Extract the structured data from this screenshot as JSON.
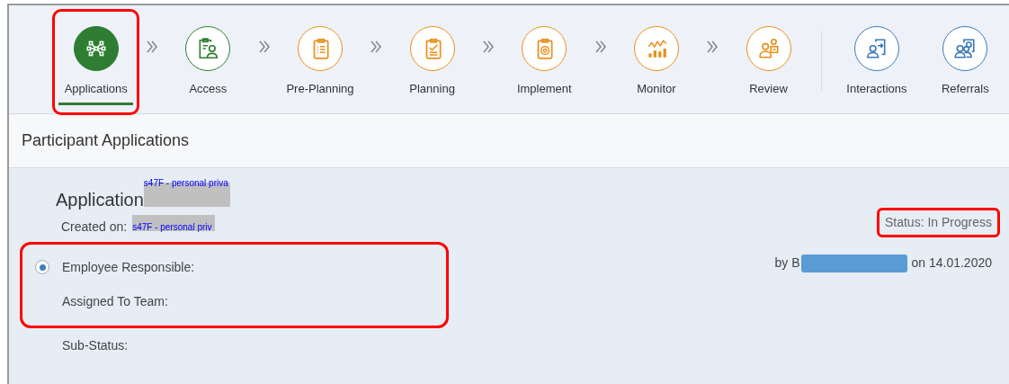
{
  "steps": [
    {
      "label": "Applications",
      "kind": "process",
      "completed": true,
      "selected": true,
      "highlighted": true
    },
    {
      "label": "Access",
      "kind": "process",
      "completed": true,
      "selected": false,
      "highlighted": false
    },
    {
      "label": "Pre-Planning",
      "kind": "process",
      "completed": false,
      "selected": false,
      "highlighted": false
    },
    {
      "label": "Planning",
      "kind": "process",
      "completed": false,
      "selected": false,
      "highlighted": false
    },
    {
      "label": "Implement",
      "kind": "process",
      "completed": false,
      "selected": false,
      "highlighted": false
    },
    {
      "label": "Monitor",
      "kind": "process",
      "completed": false,
      "selected": false,
      "highlighted": false
    },
    {
      "label": "Review",
      "kind": "process",
      "completed": false,
      "selected": false,
      "highlighted": false
    },
    {
      "label": "Interactions",
      "kind": "related",
      "selected": false,
      "highlighted": false
    },
    {
      "label": "Referrals",
      "kind": "related",
      "selected": false,
      "highlighted": false
    }
  ],
  "section_title": "Participant Applications",
  "application": {
    "title": "Application",
    "redaction_label": "s47F - personal priva",
    "created_label": "Created on:",
    "created_redaction_label": "s47F - personal priv",
    "status": "Status: In Progress",
    "status_highlighted": true,
    "by_prefix": "by B",
    "by_suffix": "on 14.01.2020",
    "fields": [
      {
        "label": "Employee Responsible:",
        "radio": {
          "selected": true
        },
        "highlighted": true
      },
      {
        "label": "Assigned To Team:",
        "highlighted": true
      },
      {
        "label": "Sub-Status:",
        "highlighted": false
      }
    ]
  }
}
